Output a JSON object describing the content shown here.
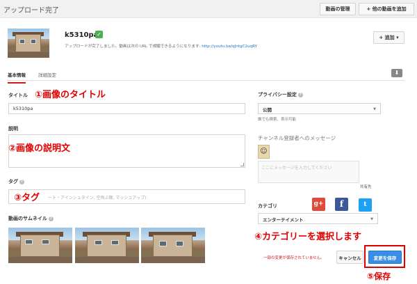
{
  "header": {
    "title": "アップロード完了",
    "manage_button": "動画の管理",
    "add_button": "+ 他の動画を追加"
  },
  "video": {
    "name": "k5310pa",
    "status_icon": "check-icon",
    "message": "アップロードが完了しました。動画は次の URL で視聴できるようになります:",
    "url": "http://youtu.be/qJntgC2uqRY",
    "add_to_button": "+ 追加 ▾"
  },
  "tabs": {
    "basic": "基本情報",
    "advanced": "詳細設定"
  },
  "form": {
    "title_label": "タイトル",
    "title_value": "k5310pa",
    "description_label": "説明",
    "description_value": "",
    "tags_label": "タグ",
    "tags_placeholder": "ート・アインシュタイン, 空飛ぶ豚, マッシュアップ)",
    "thumbnail_label": "動画のサムネイル"
  },
  "privacy": {
    "label": "プライバシー設定",
    "value": "公開",
    "hint": "誰でも検索、表示可能"
  },
  "channel": {
    "label": "チャンネル登録者へのメッセージ",
    "placeholder": "ここにメッセージを入力してください",
    "shared": "共有先"
  },
  "category": {
    "label": "カテゴリ",
    "value": "エンターテイメント"
  },
  "social": {
    "gplus": "g+",
    "facebook": "f",
    "twitter": "t"
  },
  "footer": {
    "unsaved": "一部の変更が保存されていません。",
    "cancel": "キャンセル",
    "save": "変更を保存"
  },
  "annotations": {
    "a1": "①画像のタイトル",
    "a2": "②画像の説明文",
    "a3": "③タグ",
    "a4": "④カテゴリーを選択します",
    "a5": "⑤保存"
  },
  "colors": {
    "accent_red": "#cc181e",
    "save_blue": "#3a8ee6",
    "annotation_red": "#e00000"
  }
}
